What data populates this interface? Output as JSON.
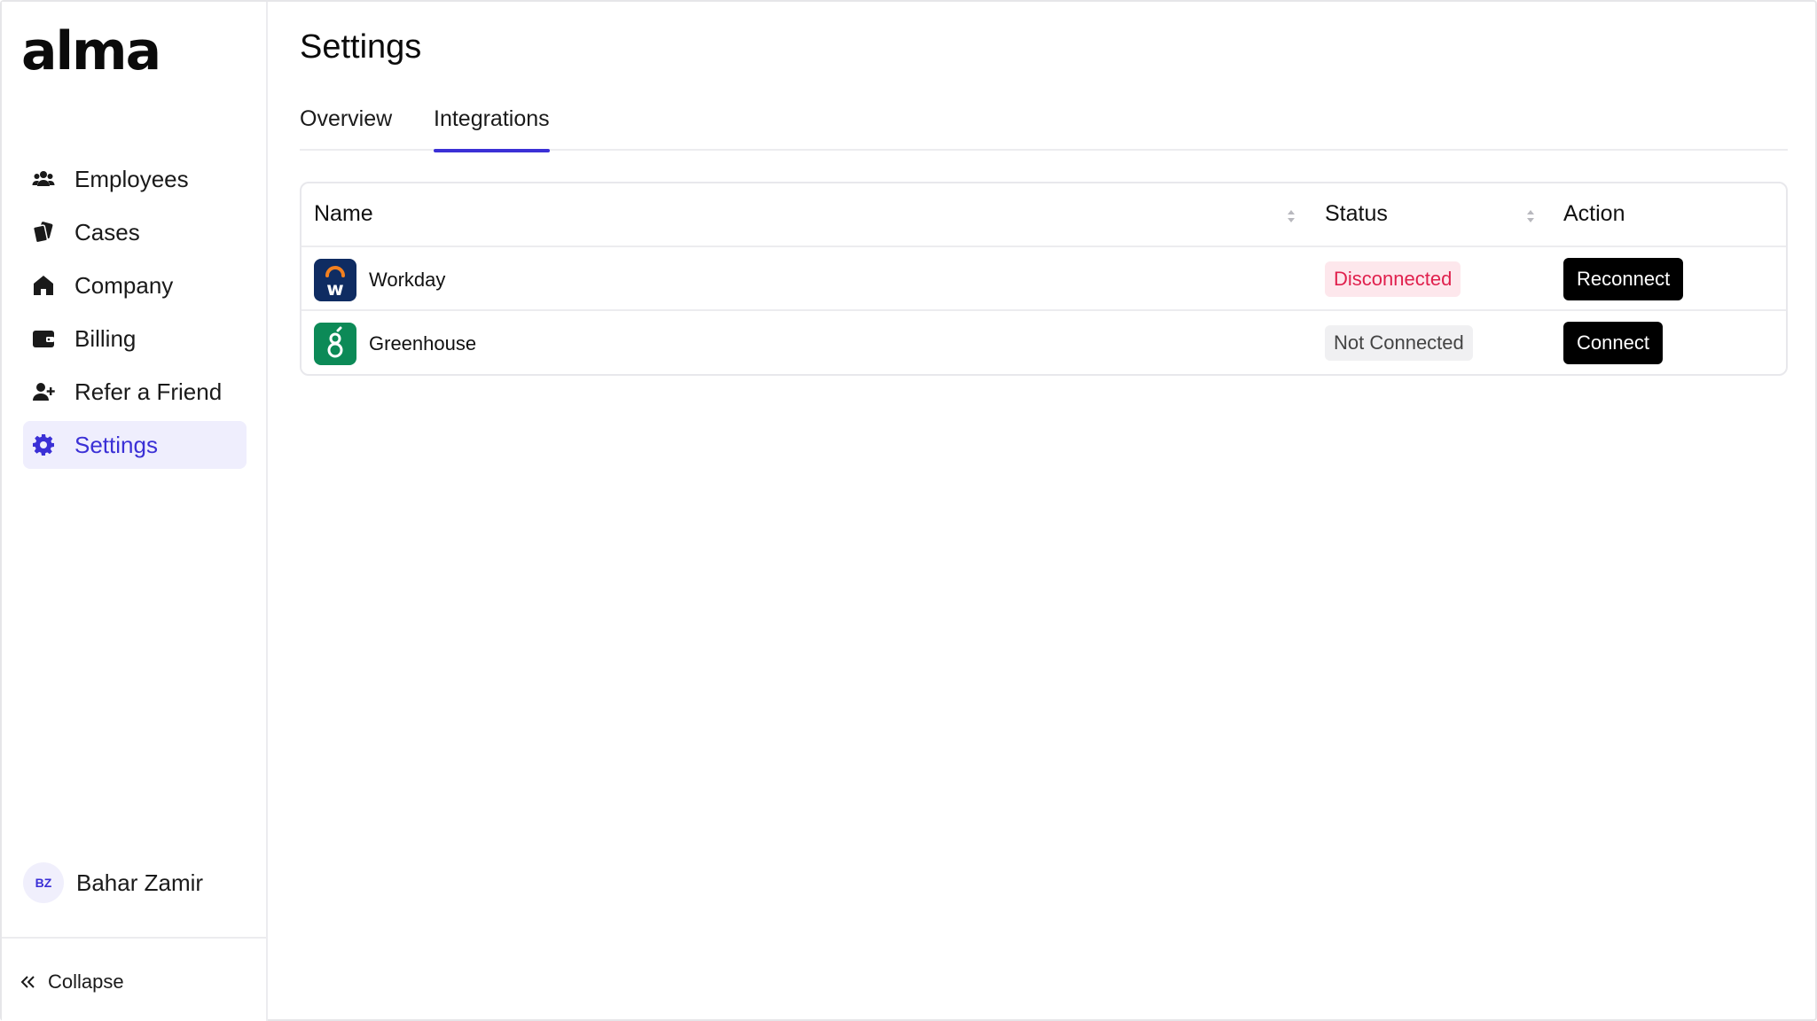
{
  "app": {
    "logo_text": "alma"
  },
  "sidebar": {
    "items": [
      {
        "label": "Employees",
        "icon": "users-icon",
        "active": false
      },
      {
        "label": "Cases",
        "icon": "cases-icon",
        "active": false
      },
      {
        "label": "Company",
        "icon": "home-icon",
        "active": false
      },
      {
        "label": "Billing",
        "icon": "wallet-icon",
        "active": false
      },
      {
        "label": "Refer a Friend",
        "icon": "user-plus-icon",
        "active": false
      },
      {
        "label": "Settings",
        "icon": "gear-icon",
        "active": true
      }
    ],
    "user": {
      "initials": "BZ",
      "name": "Bahar Zamir"
    },
    "collapse_label": "Collapse"
  },
  "page": {
    "title": "Settings",
    "tabs": [
      {
        "label": "Overview",
        "active": false
      },
      {
        "label": "Integrations",
        "active": true
      }
    ]
  },
  "table": {
    "columns": {
      "name": "Name",
      "status": "Status",
      "action": "Action"
    },
    "rows": [
      {
        "name": "Workday",
        "status": "Disconnected",
        "status_tone": "danger",
        "action": "Reconnect"
      },
      {
        "name": "Greenhouse",
        "status": "Not Connected",
        "status_tone": "neutral",
        "action": "Connect"
      }
    ]
  },
  "colors": {
    "accent": "#3b30d6",
    "accent_bg": "#efeefd",
    "danger": "#e0204d",
    "danger_bg": "#fde7ec",
    "workday_logo_bg": "#0f2c62",
    "greenhouse_logo_bg": "#0c8a57"
  }
}
